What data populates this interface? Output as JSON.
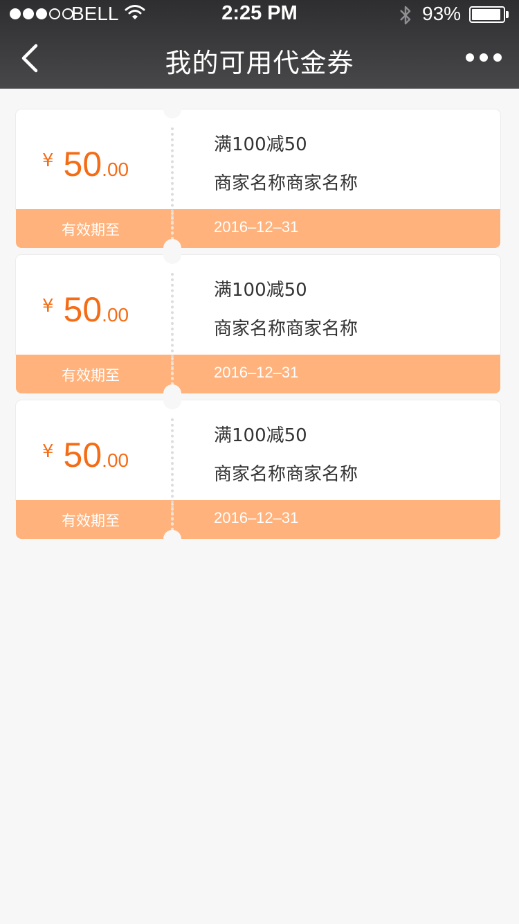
{
  "status_bar": {
    "carrier": "BELL",
    "time": "2:25 PM",
    "battery": "93%",
    "battery_level": 0.93,
    "signal_bars": 3,
    "signal_total": 5
  },
  "nav": {
    "title": "我的可用代金券",
    "back_icon": "chevron-left-icon",
    "more_icon": "more-icon"
  },
  "colors": {
    "accent": "#f46d16",
    "footer": "#ffb27b",
    "header": "#3a3a3c",
    "background": "#f7f7f7"
  },
  "coupons": [
    {
      "currency": "¥",
      "amount": "50",
      "cents": ".00",
      "rule": "满100减50",
      "merchant": "商家名称商家名称",
      "expiry_label": "有效期至",
      "expiry_date": "2016–12–31"
    },
    {
      "currency": "¥",
      "amount": "50",
      "cents": ".00",
      "rule": "满100减50",
      "merchant": "商家名称商家名称",
      "expiry_label": "有效期至",
      "expiry_date": "2016–12–31"
    },
    {
      "currency": "¥",
      "amount": "50",
      "cents": ".00",
      "rule": "满100减50",
      "merchant": "商家名称商家名称",
      "expiry_label": "有效期至",
      "expiry_date": "2016–12–31"
    }
  ]
}
